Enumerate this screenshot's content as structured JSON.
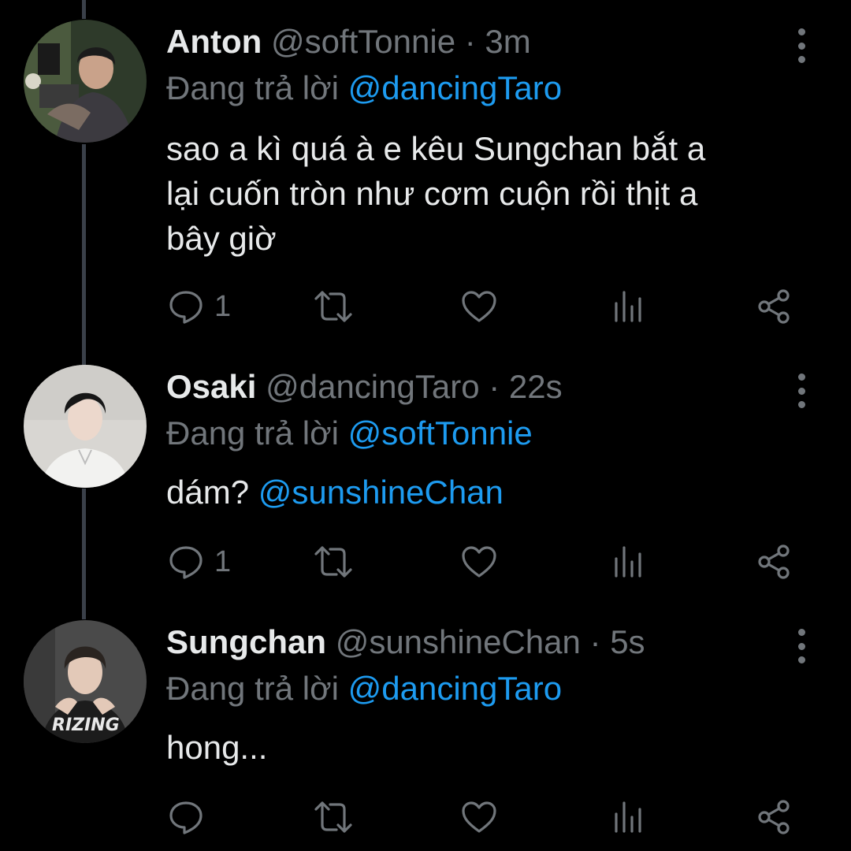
{
  "tweets": [
    {
      "display_name": "Anton",
      "handle": "@softTonnie",
      "time": "3m",
      "replying_label": "Đang trả lời",
      "replying_to": "@dancingTaro",
      "text_lines": [
        "sao a kì quá à e kêu Sungchan bắt a",
        "lại cuốn tròn như cơm cuộn rồi thịt a",
        "bây giờ"
      ],
      "reply_count": "1"
    },
    {
      "display_name": "Osaki",
      "handle": "@dancingTaro",
      "time": "22s",
      "replying_label": "Đang trả lời",
      "replying_to": "@softTonnie",
      "text": "dám?",
      "text_mention": "@sunshineChan",
      "reply_count": "1"
    },
    {
      "display_name": "Sungchan",
      "handle": "@sunshineChan",
      "time": "5s",
      "replying_label": "Đang trả lời",
      "replying_to": "@dancingTaro",
      "text": "hong...",
      "reply_count": ""
    }
  ],
  "separator": "·",
  "icons": [
    "reply-icon",
    "retweet-icon",
    "like-icon",
    "analytics-icon",
    "share-icon",
    "more-vertical-icon"
  ],
  "colors": {
    "background": "#000000",
    "text": "#e7e9ea",
    "muted": "#71767b",
    "accent": "#1d9bf0",
    "thread_line": "#3a4049"
  }
}
